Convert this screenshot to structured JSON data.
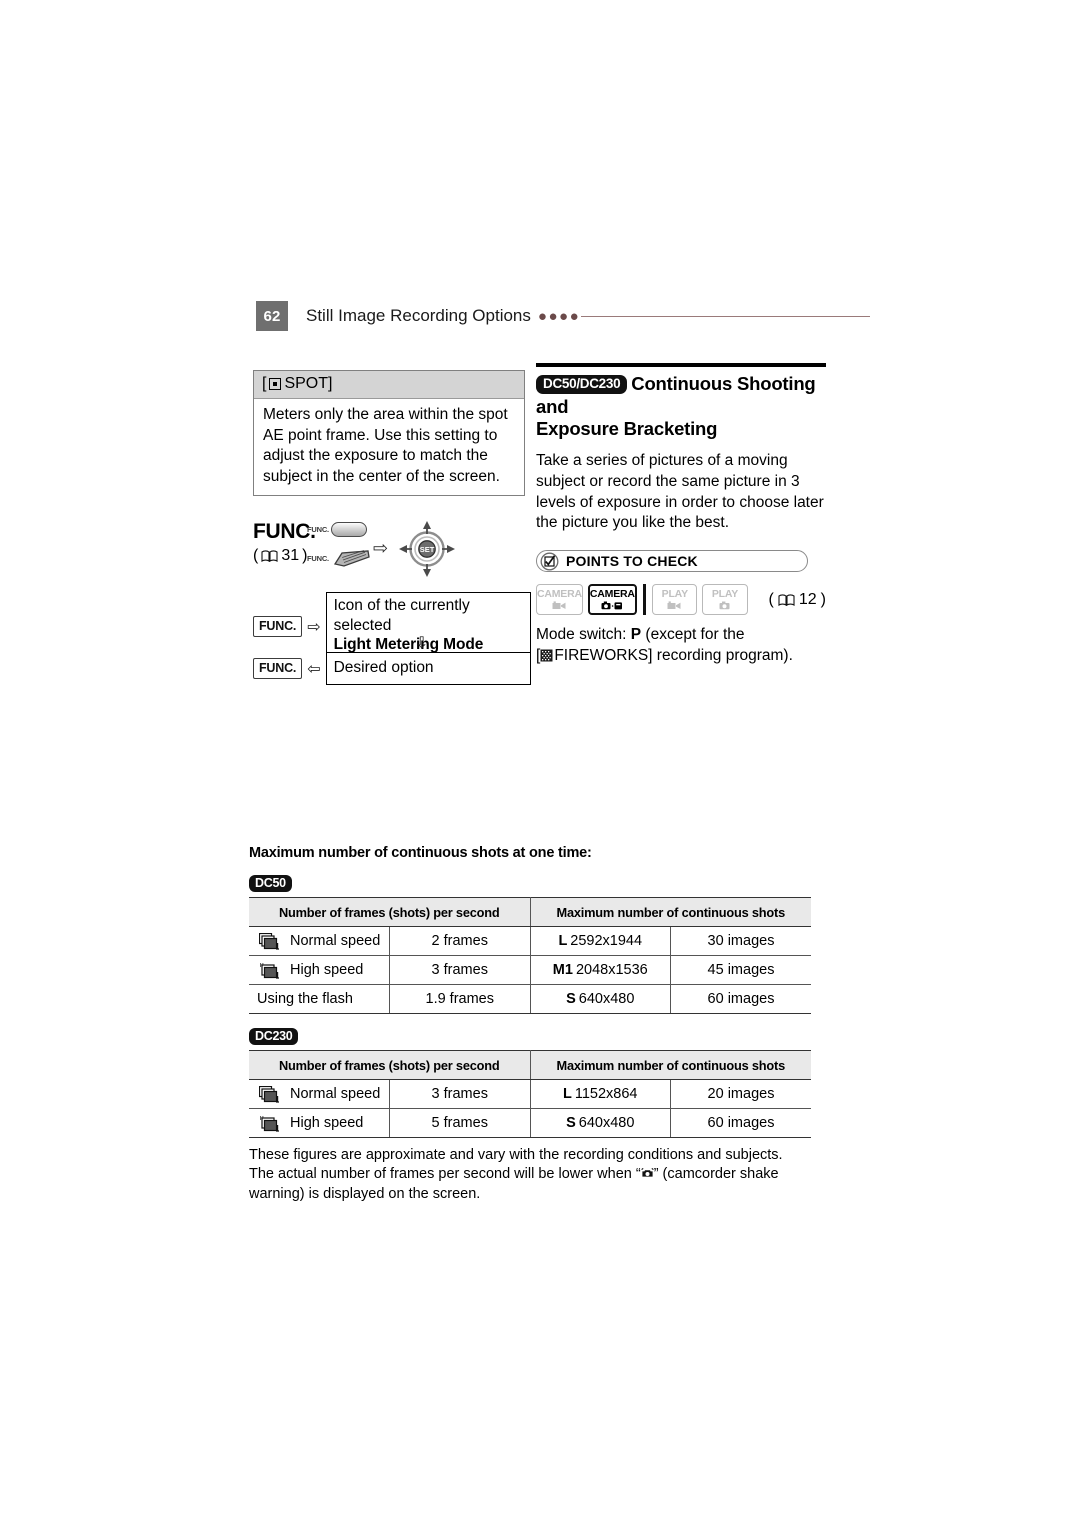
{
  "header": {
    "page_number": "62",
    "title": "Still Image Recording Options",
    "dots": "●●●●"
  },
  "spot_box": {
    "icon": "spot-metering-icon",
    "title": "SPOT]",
    "title_prefix": "[",
    "body": "Meters only the area within the spot AE point frame. Use this setting to adjust the exposure to match the subject in the center of the screen."
  },
  "func_block": {
    "title": "FUNC.",
    "reference_open": "(",
    "reference_page": "31",
    "reference_close": ")",
    "button_label_1": "FUNC.",
    "button_label_2": "FUNC.",
    "arrow_right": "⇨",
    "joystick_label": "SET",
    "step1_key": "FUNC.",
    "step1_arrow": "⇨",
    "step1_line1": "Icon of the currently selected",
    "step1_line2": "Light Metering Mode",
    "down_arrow": "⇩",
    "step2_key": "FUNC.",
    "step2_arrow": "⇦",
    "step2_text": "Desired option"
  },
  "section": {
    "model_badge": "DC50/DC230",
    "heading_line1": "Continuous Shooting and",
    "heading_line2": "Exposure Bracketing",
    "paragraph": "Take a series of pictures of a moving subject or record the same picture in 3 levels of exposure in order to choose later the picture you like the best."
  },
  "points_to_check": {
    "icon": "checkbox-check-icon",
    "label": "POINTS TO CHECK",
    "modes": [
      {
        "name": "camera-movie-mode",
        "label": "CAMERA",
        "sub_icon": "movie-camera-icon",
        "active": false
      },
      {
        "name": "camera-photo-mode",
        "label": "CAMERA",
        "sub_icon": "still-camera-card-icon",
        "active": true
      },
      {
        "name": "play-movie-mode",
        "label": "PLAY",
        "sub_icon": "movie-camera-icon",
        "active": false
      },
      {
        "name": "play-photo-mode",
        "label": "PLAY",
        "sub_icon": "still-camera-icon",
        "active": false
      }
    ],
    "reference_open": "(",
    "reference_page": "12",
    "reference_close": ")",
    "mode_switch_prefix": "Mode switch: ",
    "mode_switch_value": "P",
    "mode_switch_mid": " (except for the",
    "mode_switch_bracket_open": "[",
    "mode_switch_program": "FIREWORKS] recording program)."
  },
  "tables_section": {
    "title": "Maximum number of continuous shots at one time:",
    "tables": [
      {
        "badge": "DC50",
        "headers": [
          "Number of frames (shots) per second",
          "Maximum number of continuous shots"
        ],
        "rows": [
          {
            "icon": "burst-normal-icon",
            "mode": "Normal speed",
            "frames": "2 frames",
            "size_label": "L",
            "size_value": "2592x1944",
            "images": "30 images"
          },
          {
            "icon": "burst-high-icon",
            "mode": "High speed",
            "frames": "3 frames",
            "size_label": "M1",
            "size_value": "2048x1536",
            "images": "45 images"
          },
          {
            "icon": "",
            "mode": "Using the flash",
            "frames": "1.9 frames",
            "size_label": "S",
            "size_value": "640x480",
            "images": "60 images"
          }
        ]
      },
      {
        "badge": "DC230",
        "headers": [
          "Number of frames (shots) per second",
          "Maximum number of continuous shots"
        ],
        "rows": [
          {
            "icon": "burst-normal-icon",
            "mode": "Normal speed",
            "frames": "3 frames",
            "size_label": "L",
            "size_value": "1152x864",
            "images": "20 images"
          },
          {
            "icon": "burst-high-icon",
            "mode": "High speed",
            "frames": "5 frames",
            "size_label": "S",
            "size_value": "640x480",
            "images": "60 images"
          }
        ]
      }
    ],
    "footnote_1": "These figures are approximate and vary with the recording conditions and subjects.",
    "footnote_2a": "The actual number of frames per second will be lower when “",
    "footnote_2b": "” (camcorder shake warning) is displayed on the screen."
  },
  "colors": {
    "page_badge": "#6f6f6f",
    "rule": "#9a7a7a",
    "table_header_bg": "#e9e9e9",
    "spot_header_bg": "#d4d4d4",
    "badge_black": "#111111"
  }
}
